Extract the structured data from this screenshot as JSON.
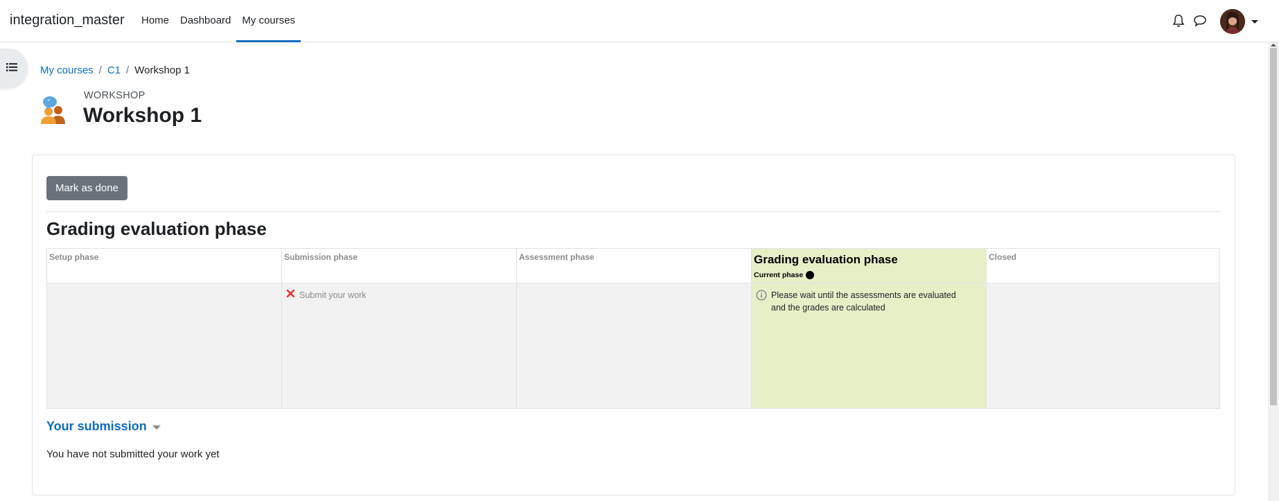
{
  "navbar": {
    "brand": "integration_master",
    "links": [
      {
        "label": "Home",
        "active": false
      },
      {
        "label": "Dashboard",
        "active": false
      },
      {
        "label": "My courses",
        "active": true
      }
    ]
  },
  "breadcrumb": {
    "items": [
      "My courses",
      "C1"
    ],
    "current": "Workshop 1",
    "separator": "/"
  },
  "header": {
    "activity_type": "WORKSHOP",
    "title": "Workshop 1"
  },
  "card": {
    "mark_done_label": "Mark as done",
    "phase_heading": "Grading evaluation phase",
    "phases": [
      {
        "name": "Setup phase",
        "current": false,
        "tasks": []
      },
      {
        "name": "Submission phase",
        "current": false,
        "tasks": [
          {
            "status": "todo",
            "text": "Submit your work"
          }
        ]
      },
      {
        "name": "Assessment phase",
        "current": false,
        "tasks": []
      },
      {
        "name": "Grading evaluation phase",
        "current": true,
        "current_label": "Current phase",
        "tasks": [
          {
            "status": "info",
            "text": "Please wait until the assessments are evaluated and the grades are calculated"
          }
        ]
      },
      {
        "name": "Closed",
        "current": false,
        "tasks": []
      }
    ],
    "submission": {
      "heading": "Your submission",
      "text": "You have not submitted your work yet"
    }
  },
  "colors": {
    "link": "#0f6cbf",
    "current_phase_bg": "#e7efc7",
    "phase_body_bg": "#f2f2f2",
    "button_bg": "#6a737b",
    "todo_icon": "#e12d2d"
  },
  "icons": [
    "bell-icon",
    "chat-icon",
    "user-avatar",
    "list-icon",
    "workshop-icon",
    "cross-icon",
    "info-icon"
  ]
}
